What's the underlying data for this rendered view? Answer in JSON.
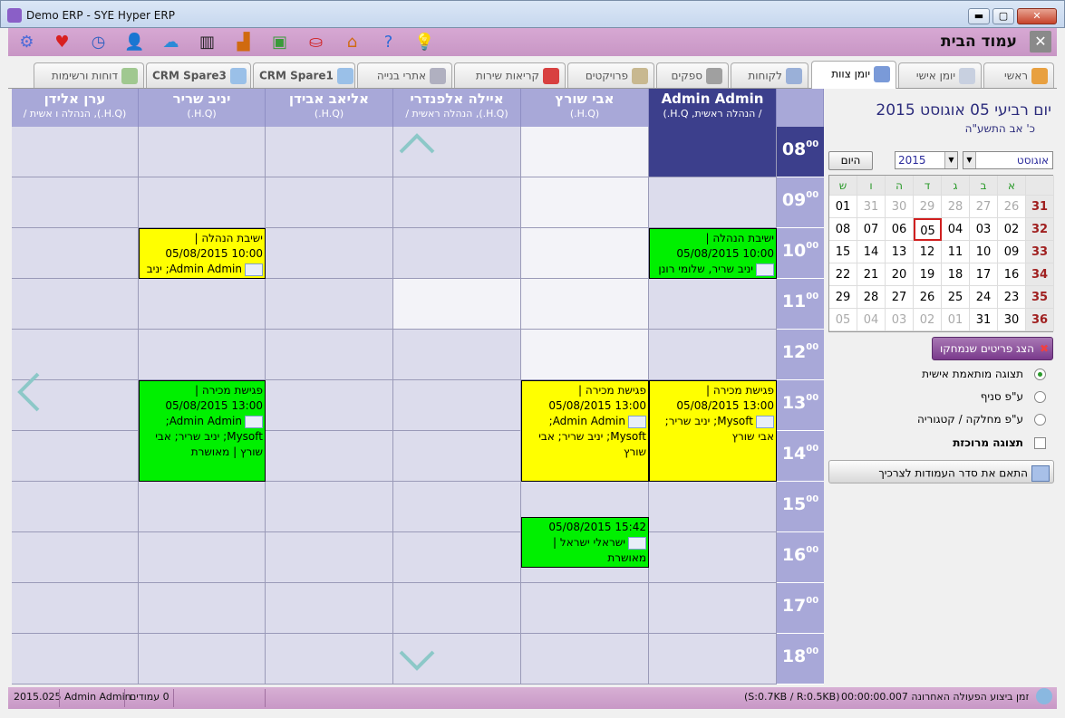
{
  "window": {
    "title": "Demo ERP - SYE Hyper ERP",
    "close_label": "✕",
    "min_label": "▬",
    "max_label": "▢"
  },
  "toolbar": {
    "icons": [
      "gear-icon",
      "heart-icon",
      "clock-icon",
      "users-icon",
      "cloud-icon",
      "barcode-icon",
      "factory-icon",
      "money-icon",
      "basket-icon",
      "home-icon",
      "help-icon",
      "bulb-icon"
    ],
    "page_title": "עמוד הבית",
    "close_label": "✕"
  },
  "tabs": [
    {
      "label": "ראשי"
    },
    {
      "label": "יומן אישי"
    },
    {
      "label": "יומן צוות"
    },
    {
      "label": "לקוחות"
    },
    {
      "label": "ספקים"
    },
    {
      "label": "פרויקטים"
    },
    {
      "label": "קריאות שירות"
    },
    {
      "label": "אתרי בנייה"
    },
    {
      "label": "CRM Spare1"
    },
    {
      "label": "CRM Spare3"
    },
    {
      "label": "דוחות ורשימות"
    }
  ],
  "schedule": {
    "columns": [
      {
        "name": "Admin Admin",
        "sub": "/ הנהלה ראשית, H.Q.)"
      },
      {
        "name": "אבי שורץ",
        "sub": "(H.Q.)"
      },
      {
        "name": "איילה אלפנדרי",
        "sub": "(H.Q.), הנהלה ראשית /"
      },
      {
        "name": "אליאב אבידן",
        "sub": "(H.Q.)"
      },
      {
        "name": "יניב שריר",
        "sub": "(H.Q.)"
      },
      {
        "name": "ערן אלידן",
        "sub": "(H.Q.), הנהלה ו אשית /"
      }
    ],
    "hours": [
      "08",
      "09",
      "10",
      "11",
      "12",
      "13",
      "14",
      "15",
      "16",
      "17",
      "18"
    ],
    "minutes": "00",
    "events": [
      {
        "l1": "ישיבת הנהלה |",
        "l2": "10:00 05/08/2015",
        "l3": "יניב שריר, שלומי רונן",
        "l4": ""
      },
      {
        "l1": "ישיבת הנהלה |",
        "l2": "10:00 05/08/2015",
        "l3": "Admin Admin; יניב",
        "l4": ""
      },
      {
        "l1": "פגישת מכירה |",
        "l2": "13:00 05/08/2015",
        "l3": "Mysoft; יניב שריר;",
        "l4": "אבי שורץ"
      },
      {
        "l1": "פגישת מכירה |",
        "l2": "13:00 05/08/2015",
        "l3": "Admin Admin;",
        "l4": "Mysoft; יניב שריר; אבי שורץ"
      },
      {
        "l1": "פגישת מכירה |",
        "l2": "13:00 05/08/2015",
        "l3": "Admin Admin;",
        "l4": "Mysoft; יניב שריר; אבי שורץ | מאושרת"
      },
      {
        "l1": "15:42 05/08/2015",
        "l2": "ישראלי ישראל |",
        "l3": "מאושרת",
        "l4": ""
      }
    ]
  },
  "panel": {
    "date_title": "יום רביעי 05 אוגוסט 2015",
    "hebrew_date": "כ' אב התשע\"ה",
    "today_label": "היום",
    "year_value": "2015",
    "month_value": "אוגוסט",
    "cal_headers": [
      "א",
      "ב",
      "ג",
      "ד",
      "ה",
      "ו",
      "ש"
    ],
    "cal_weeks": [
      {
        "wk": "31",
        "days": [
          "26",
          "27",
          "28",
          "29",
          "30",
          "31",
          "01"
        ]
      },
      {
        "wk": "32",
        "days": [
          "02",
          "03",
          "04",
          "05",
          "06",
          "07",
          "08"
        ]
      },
      {
        "wk": "33",
        "days": [
          "09",
          "10",
          "11",
          "12",
          "13",
          "14",
          "15"
        ]
      },
      {
        "wk": "34",
        "days": [
          "16",
          "17",
          "18",
          "19",
          "20",
          "21",
          "22"
        ]
      },
      {
        "wk": "35",
        "days": [
          "23",
          "24",
          "25",
          "26",
          "27",
          "28",
          "29"
        ]
      },
      {
        "wk": "36",
        "days": [
          "30",
          "31",
          "01",
          "02",
          "03",
          "04",
          "05"
        ]
      }
    ],
    "show_deleted": "הצג פריטים שנמחקו",
    "option_personal": "תצוגה מותאמת אישית",
    "option_branch": "ע\"פ סניף",
    "option_dept": "ע\"פ מחלקה / קטגוריה",
    "option_compact": "תצוגה מרוכזת",
    "fit_columns": "התאם את סדר העמודות לצרכיך"
  },
  "status": {
    "version": "2015.025",
    "user": "Admin Admin",
    "columns_count": "0 עמודים",
    "traffic": "(S:0.7KB / R:0.5KB)",
    "last_action": "00:00:00.007  זמן ביצוע הפעולה האחרונה"
  },
  "colors": {
    "accent_purple": "#c896c5",
    "header_blue": "#a8a8d8",
    "selected_blue": "#3c3f8c",
    "event_green": "#00f000",
    "event_yellow": "#ffff00"
  }
}
